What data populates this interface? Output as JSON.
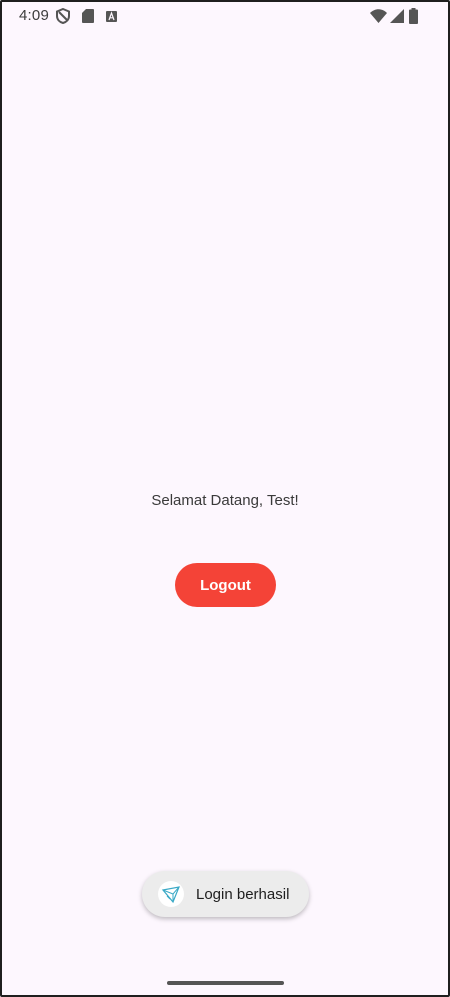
{
  "status_bar": {
    "time": "4:09",
    "left_icons": [
      "shield-icon",
      "sd-card-icon",
      "keyboard-a-icon"
    ],
    "right_icons": [
      "wifi-icon",
      "signal-icon",
      "battery-icon"
    ]
  },
  "main": {
    "greeting": "Selamat Datang, Test!",
    "logout_label": "Logout",
    "accent_color": "#f44337"
  },
  "toast": {
    "icon": "app-logo-icon",
    "message": "Login berhasil"
  },
  "background_color": "#fdf7fe"
}
